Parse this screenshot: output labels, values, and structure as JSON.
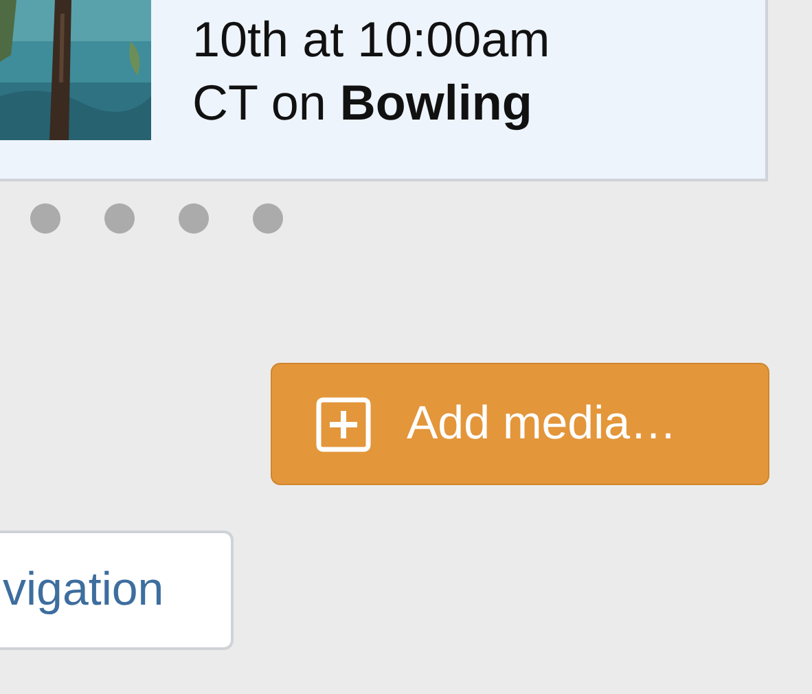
{
  "event_card": {
    "text_lines": [
      "10th at 10:00am",
      "CT on **Bowling**"
    ]
  },
  "carousel_dots": [
    {
      "selected": false
    },
    {
      "selected": false
    },
    {
      "selected": false
    },
    {
      "selected": false
    }
  ],
  "add_media_button": {
    "label": "Add media…"
  },
  "navigation_button": {
    "label": "vigation"
  }
}
